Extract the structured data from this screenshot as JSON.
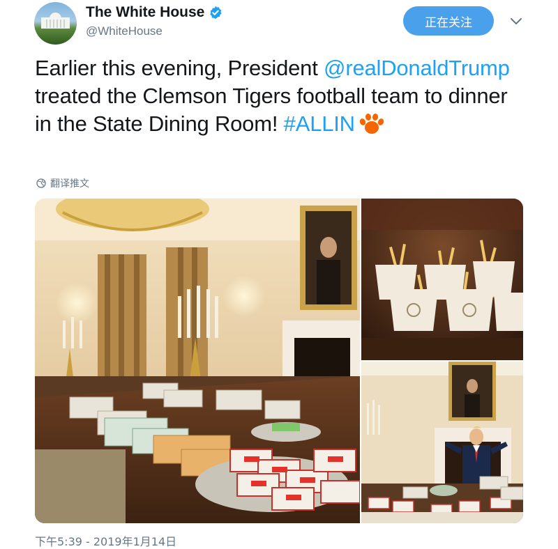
{
  "header": {
    "display_name": "The White House",
    "handle": "@WhiteHouse",
    "follow_label": "正在关注"
  },
  "icons": {
    "verified": "verified-badge-icon",
    "caret": "chevron-down-icon",
    "globe": "globe-icon",
    "paw": "tiger-paw-emoji"
  },
  "tweet": {
    "part1": "Earlier this evening, President ",
    "mention": "@realDonaldTrump",
    "part2": " treated the Clemson Tigers football team to dinner in the State Dining Room! ",
    "hashtag": "#ALLIN"
  },
  "translate_label": "翻译推文",
  "timestamp": "下午5:39 - 2019年1月14日",
  "colors": {
    "link": "#1da1f2",
    "follow_button": "#4ba0eb",
    "secondary_text": "#657786",
    "paw": "#f56600"
  }
}
